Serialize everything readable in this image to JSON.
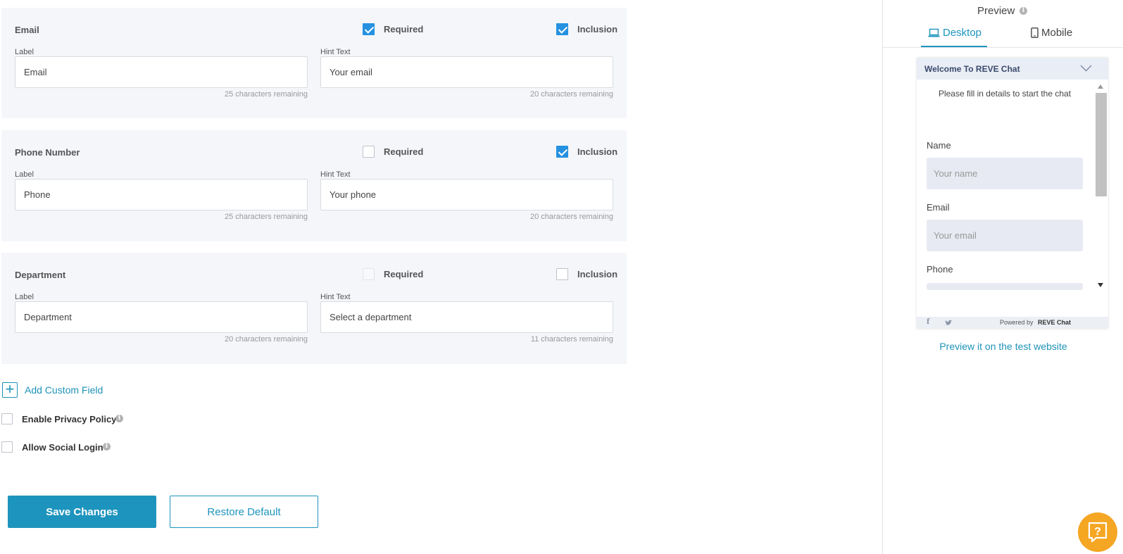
{
  "fields": [
    {
      "title": "Email",
      "required_label": "Required",
      "inclusion_label": "Inclusion",
      "label_caption": "Label",
      "hint_caption": "Hint Text",
      "label_value": "Email",
      "hint_value": "Your email",
      "label_remaining": "25 characters remaining",
      "hint_remaining": "20 characters remaining",
      "required_checked": true,
      "inclusion_checked": true
    },
    {
      "title": "Phone Number",
      "required_label": "Required",
      "inclusion_label": "Inclusion",
      "label_caption": "Label",
      "hint_caption": "Hint Text",
      "label_value": "Phone",
      "hint_value": "Your phone",
      "label_remaining": "25 characters remaining",
      "hint_remaining": "20 characters remaining",
      "required_checked": false,
      "inclusion_checked": true
    },
    {
      "title": "Department",
      "required_label": "Required",
      "inclusion_label": "Inclusion",
      "label_caption": "Label",
      "hint_caption": "Hint Text",
      "label_value": "Department",
      "hint_value": "Select a department",
      "label_remaining": "20 characters remaining",
      "hint_remaining": "11 characters remaining",
      "required_checked": false,
      "inclusion_checked": false
    }
  ],
  "add_custom_field": "Add Custom Field",
  "privacy_policy": {
    "label": "Enable Privacy Policy",
    "checked": false
  },
  "social_login": {
    "label": "Allow Social Login",
    "checked": false
  },
  "buttons": {
    "save": "Save Changes",
    "restore": "Restore Default"
  },
  "preview": {
    "title": "Preview",
    "tabs": [
      {
        "label": "Desktop",
        "icon": "laptop-icon",
        "active": true
      },
      {
        "label": "Mobile",
        "icon": "mobile-icon",
        "active": false
      }
    ],
    "chat": {
      "header": "Welcome To REVE Chat",
      "intro": "Please fill in details to start the chat",
      "fields": [
        {
          "label": "Name",
          "placeholder": "Your name"
        },
        {
          "label": "Email",
          "placeholder": "Your email"
        },
        {
          "label": "Phone",
          "placeholder": ""
        }
      ],
      "powered_by": "Powered by",
      "brand": "REVE Chat"
    },
    "test_link": "Preview it on the test website"
  },
  "colors": {
    "accent": "#1d94bd",
    "checkbox": "#2591e0",
    "help": "#f5a623"
  }
}
